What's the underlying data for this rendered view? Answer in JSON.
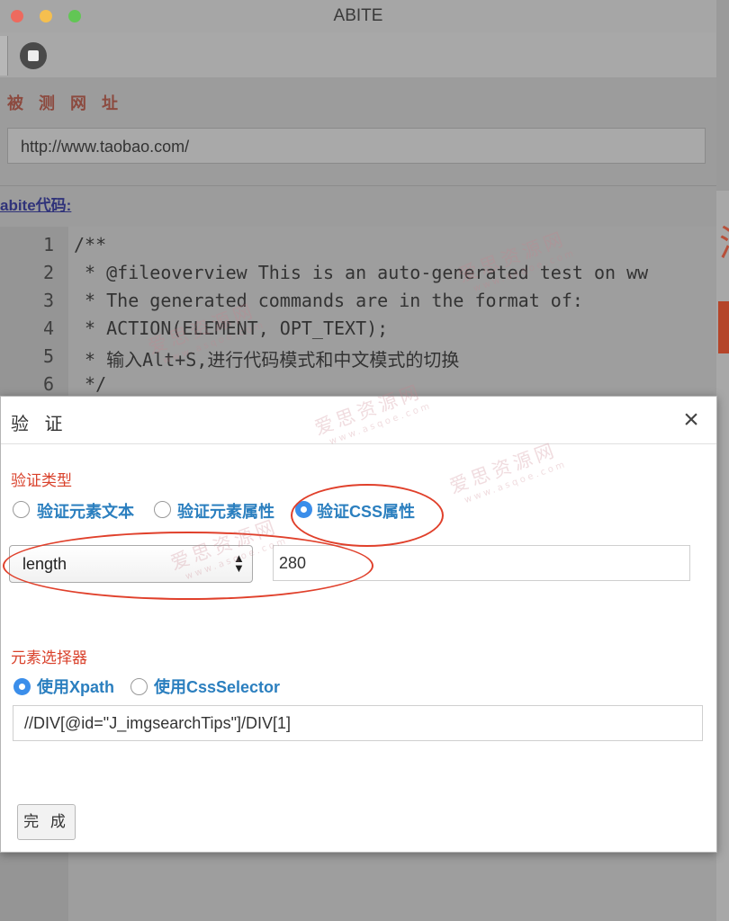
{
  "window": {
    "title": "ABITE"
  },
  "toolbar": {
    "stop_icon": "stop-icon"
  },
  "url_section": {
    "label": "被 测 网 址",
    "value": "http://www.taobao.com/"
  },
  "code_section": {
    "label": "abite代码:",
    "line_numbers": [
      "1",
      "2",
      "3",
      "4",
      "5",
      "6"
    ],
    "lines": [
      "/**",
      " * @fileoverview This is an auto-generated test on ww",
      " * The generated commands are in the format of:",
      " * ACTION(ELEMENT, OPT_TEXT);",
      " * 输入Alt+S,进行代码模式和中文模式的切换",
      " */"
    ]
  },
  "background_page": {
    "char": "涉",
    "accent_color": "#b5452a"
  },
  "dialog": {
    "title": "验 证",
    "close_icon": "×",
    "verify_type": {
      "label": "验证类型",
      "options": [
        "验证元素文本",
        "验证元素属性",
        "验证CSS属性"
      ],
      "selected": "验证CSS属性"
    },
    "css_property": {
      "selected": "length",
      "value": "280"
    },
    "selector": {
      "label": "元素选择器",
      "options": [
        "使用Xpath",
        "使用CssSelector"
      ],
      "selected": "使用Xpath",
      "value": "//DIV[@id=\"J_imgsearchTips\"]/DIV[1]"
    },
    "done_label": "完 成"
  },
  "watermark": {
    "text": "爱思资源网",
    "sub": "www.asqoe.com"
  },
  "colors": {
    "accent_red": "#d9412b",
    "link_blue": "#2b7fbf",
    "radio_blue": "#3b8eea"
  }
}
